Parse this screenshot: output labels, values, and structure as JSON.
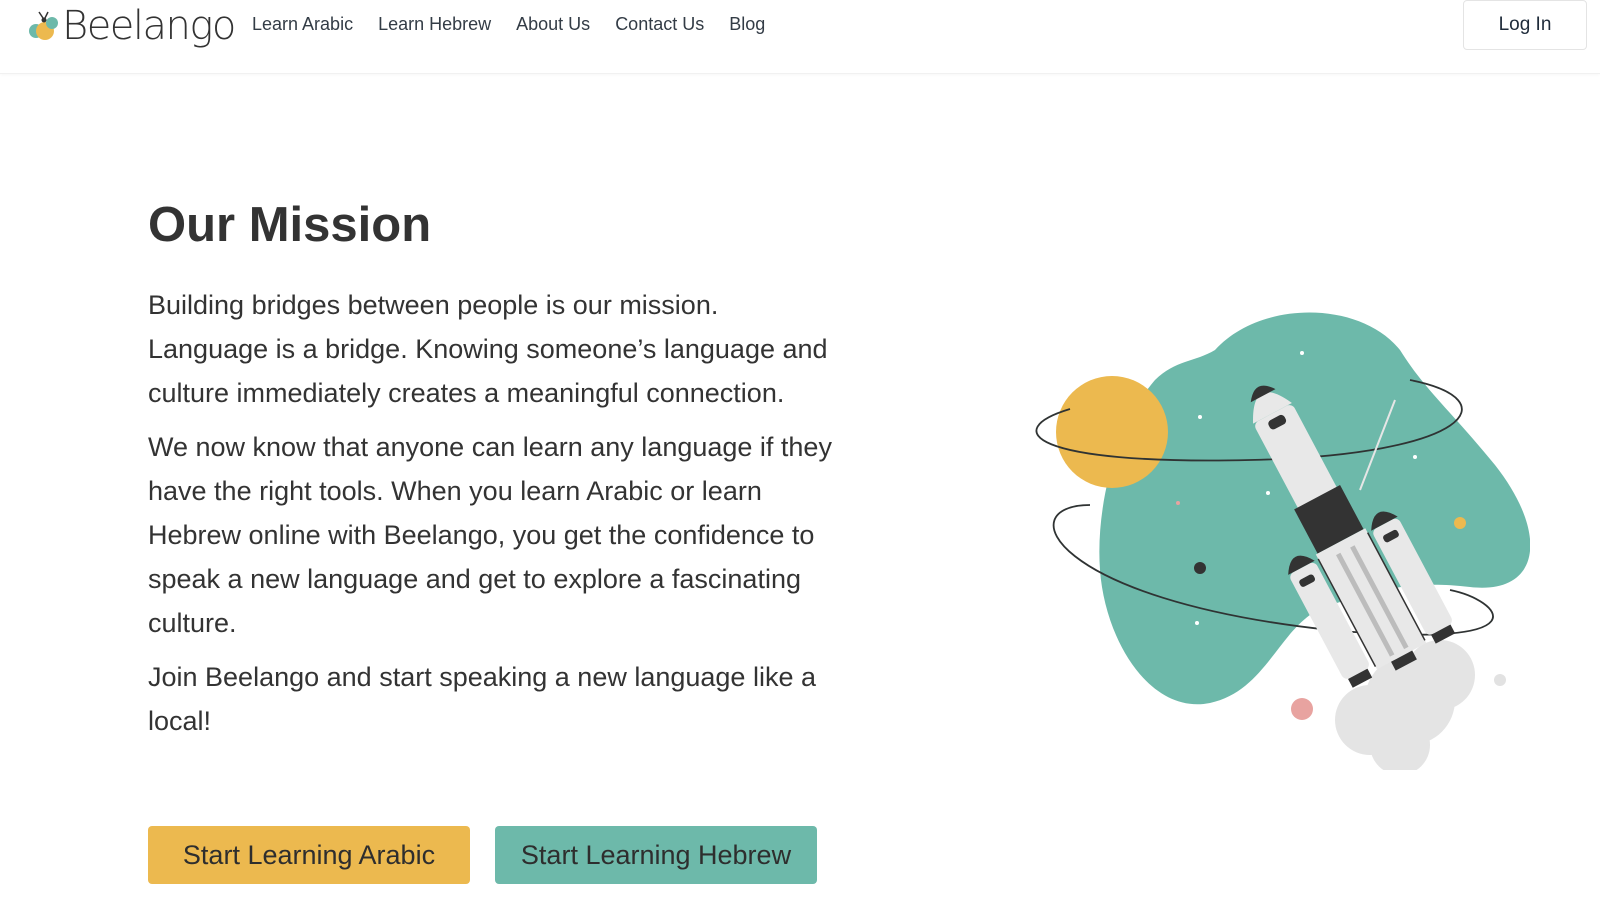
{
  "brand": {
    "name": "Beelango",
    "colors": {
      "yellow": "#ecb94f",
      "teal": "#6db9aa",
      "text": "#333333"
    }
  },
  "nav": {
    "items": [
      {
        "label": "Learn Arabic"
      },
      {
        "label": "Learn Hebrew"
      },
      {
        "label": "About Us"
      },
      {
        "label": "Contact Us"
      },
      {
        "label": "Blog"
      }
    ],
    "login_label": "Log In"
  },
  "mission": {
    "title": "Our Mission",
    "paragraphs": [
      "Building bridges between people is our mission. Language is a bridge. Knowing someone’s language and culture immediately creates a meaningful connection.",
      "We now know that anyone can learn any language if they have the right tools. When you learn Arabic or learn Hebrew online with Beelango, you get the confidence to speak a new language and get to explore a fascinating culture.",
      "Join Beelango and start speaking a new language like a local!"
    ]
  },
  "cta": {
    "arabic_label": "Start Learning Arabic",
    "hebrew_label": "Start Learning Hebrew"
  },
  "illustration": {
    "icon": "rocket-illustration"
  }
}
